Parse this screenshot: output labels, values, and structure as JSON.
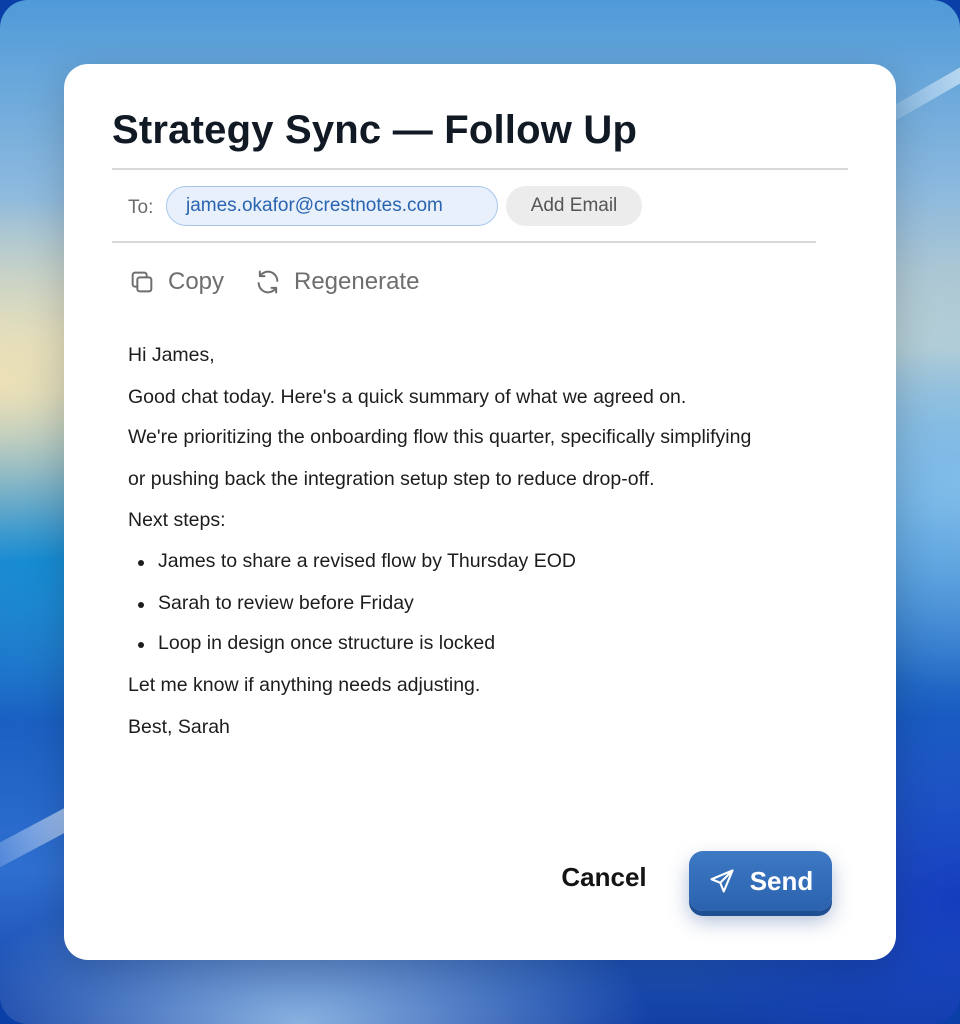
{
  "dialog": {
    "title": "Strategy Sync — Follow Up"
  },
  "recipients": {
    "to_label": "To:",
    "emails": [
      "james.okafor@crestnotes.com"
    ],
    "add_email_label": "Add Email"
  },
  "toolbar": {
    "copy_label": "Copy",
    "copy_icon": "copy-icon",
    "regenerate_label": "Regenerate",
    "regenerate_icon": "refresh-icon"
  },
  "message": {
    "greeting": "Hi James,",
    "intro": "Good chat today. Here's a quick summary of what we agreed on.",
    "summary_line1": "We're prioritizing the onboarding flow this quarter, specifically simplifying",
    "summary_line2": "or pushing back the integration setup step to reduce drop-off.",
    "next_steps_heading": "Next steps:",
    "next_steps": [
      "James to share a revised flow by Thursday EOD",
      "Sarah to review before Friday",
      "Loop in design once structure is locked"
    ],
    "closing": "Let me know if anything needs adjusting.",
    "signoff": "Best, Sarah"
  },
  "actions": {
    "cancel_label": "Cancel",
    "send_label": "Send",
    "send_icon": "send-icon"
  },
  "colors": {
    "accent": "#2b62ae",
    "chip_bg": "#e7f0fb",
    "chip_text": "#2a64b0"
  }
}
